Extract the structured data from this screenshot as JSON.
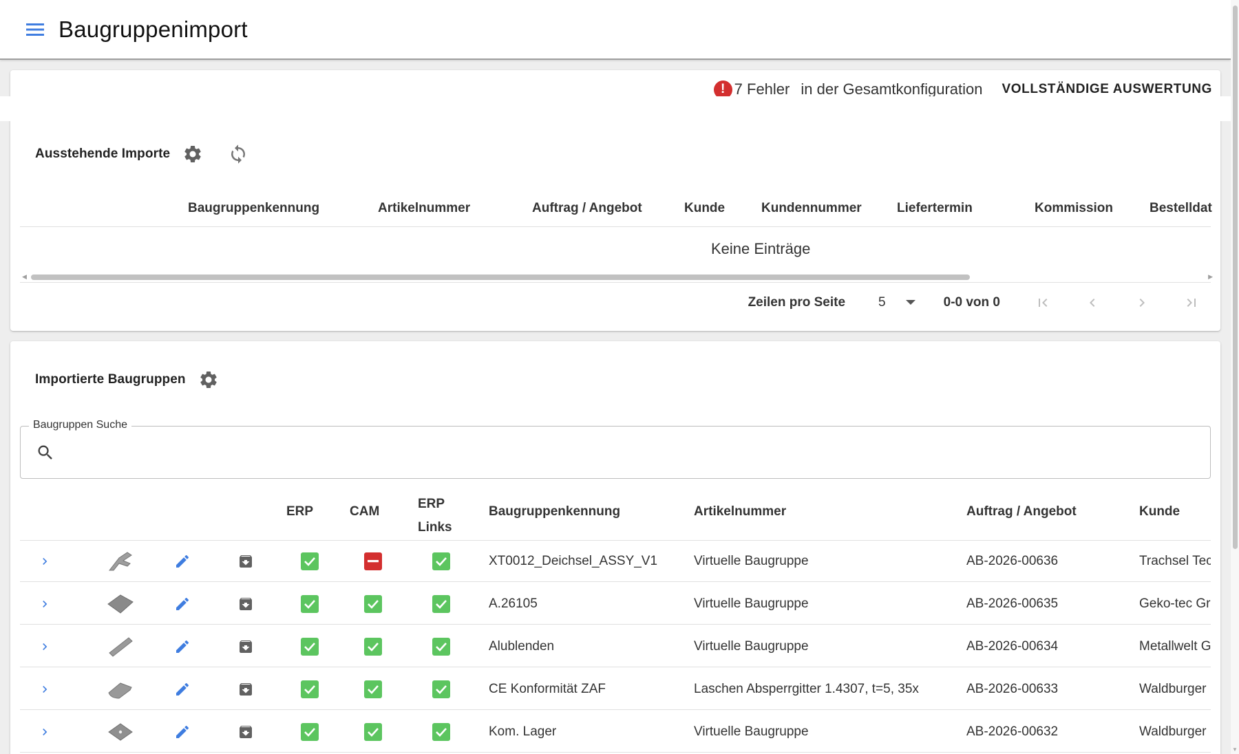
{
  "app": {
    "title": "Baugruppenimport"
  },
  "errors": {
    "count_text": "7 Fehler",
    "text": "in der Gesamtkonfiguration",
    "button": "VOLLSTÄNDIGE AUSWERTUNG",
    "error_color": "#d32f2f"
  },
  "pending": {
    "title": "Ausstehende Importe",
    "columns": [
      "Baugruppenkennung",
      "Artikelnummer",
      "Auftrag / Angebot",
      "Kunde",
      "Kundennummer",
      "Liefertermin",
      "Kommission",
      "Bestelldat"
    ],
    "empty_text": "Keine Einträge",
    "pagination": {
      "rows_label": "Zeilen pro Seite",
      "rows_per_page": "5",
      "range": "0-0 von 0"
    }
  },
  "imported": {
    "title": "Importierte Baugruppen",
    "search": {
      "label": "Baugruppen Suche",
      "value": "",
      "placeholder": ""
    },
    "columns": {
      "erp": "ERP",
      "cam": "CAM",
      "erp_links_1": "ERP",
      "erp_links_2": "Links",
      "kennung": "Baugruppenkennung",
      "artikel": "Artikelnummer",
      "auftrag": "Auftrag / Angebot",
      "kunde": "Kunde"
    },
    "rows": [
      {
        "thumbnail": "bracket-part-icon",
        "erp": true,
        "cam": false,
        "erp_links": true,
        "kennung": "XT0012_Deichsel_ASSY_V1",
        "artikel": "Virtuelle Baugruppe",
        "auftrag": "AB-2026-00636",
        "kunde": "Trachsel Tec"
      },
      {
        "thumbnail": "plate-part-icon",
        "erp": true,
        "cam": true,
        "erp_links": true,
        "kennung": "A.26105",
        "artikel": "Virtuelle Baugruppe",
        "auftrag": "AB-2026-00635",
        "kunde": "Geko-tec Gr"
      },
      {
        "thumbnail": "bar-part-icon",
        "erp": true,
        "cam": true,
        "erp_links": true,
        "kennung": "Alublenden",
        "artikel": "Virtuelle Baugruppe",
        "auftrag": "AB-2026-00634",
        "kunde": "Metallwelt G"
      },
      {
        "thumbnail": "tab-part-icon",
        "erp": true,
        "cam": true,
        "erp_links": true,
        "kennung": "CE Konformität ZAF",
        "artikel": "Laschen Absperrgitter 1.4307, t=5, 35x",
        "auftrag": "AB-2026-00633",
        "kunde": "Waldburger"
      },
      {
        "thumbnail": "flange-part-icon",
        "erp": true,
        "cam": true,
        "erp_links": true,
        "kennung": "Kom. Lager",
        "artikel": "Virtuelle Baugruppe",
        "auftrag": "AB-2026-00632",
        "kunde": "Waldburger"
      }
    ]
  },
  "colors": {
    "accent": "#3f7de0",
    "check_ok": "#5cc55f",
    "check_error": "#d32f2f",
    "icon_grey": "#616161"
  }
}
